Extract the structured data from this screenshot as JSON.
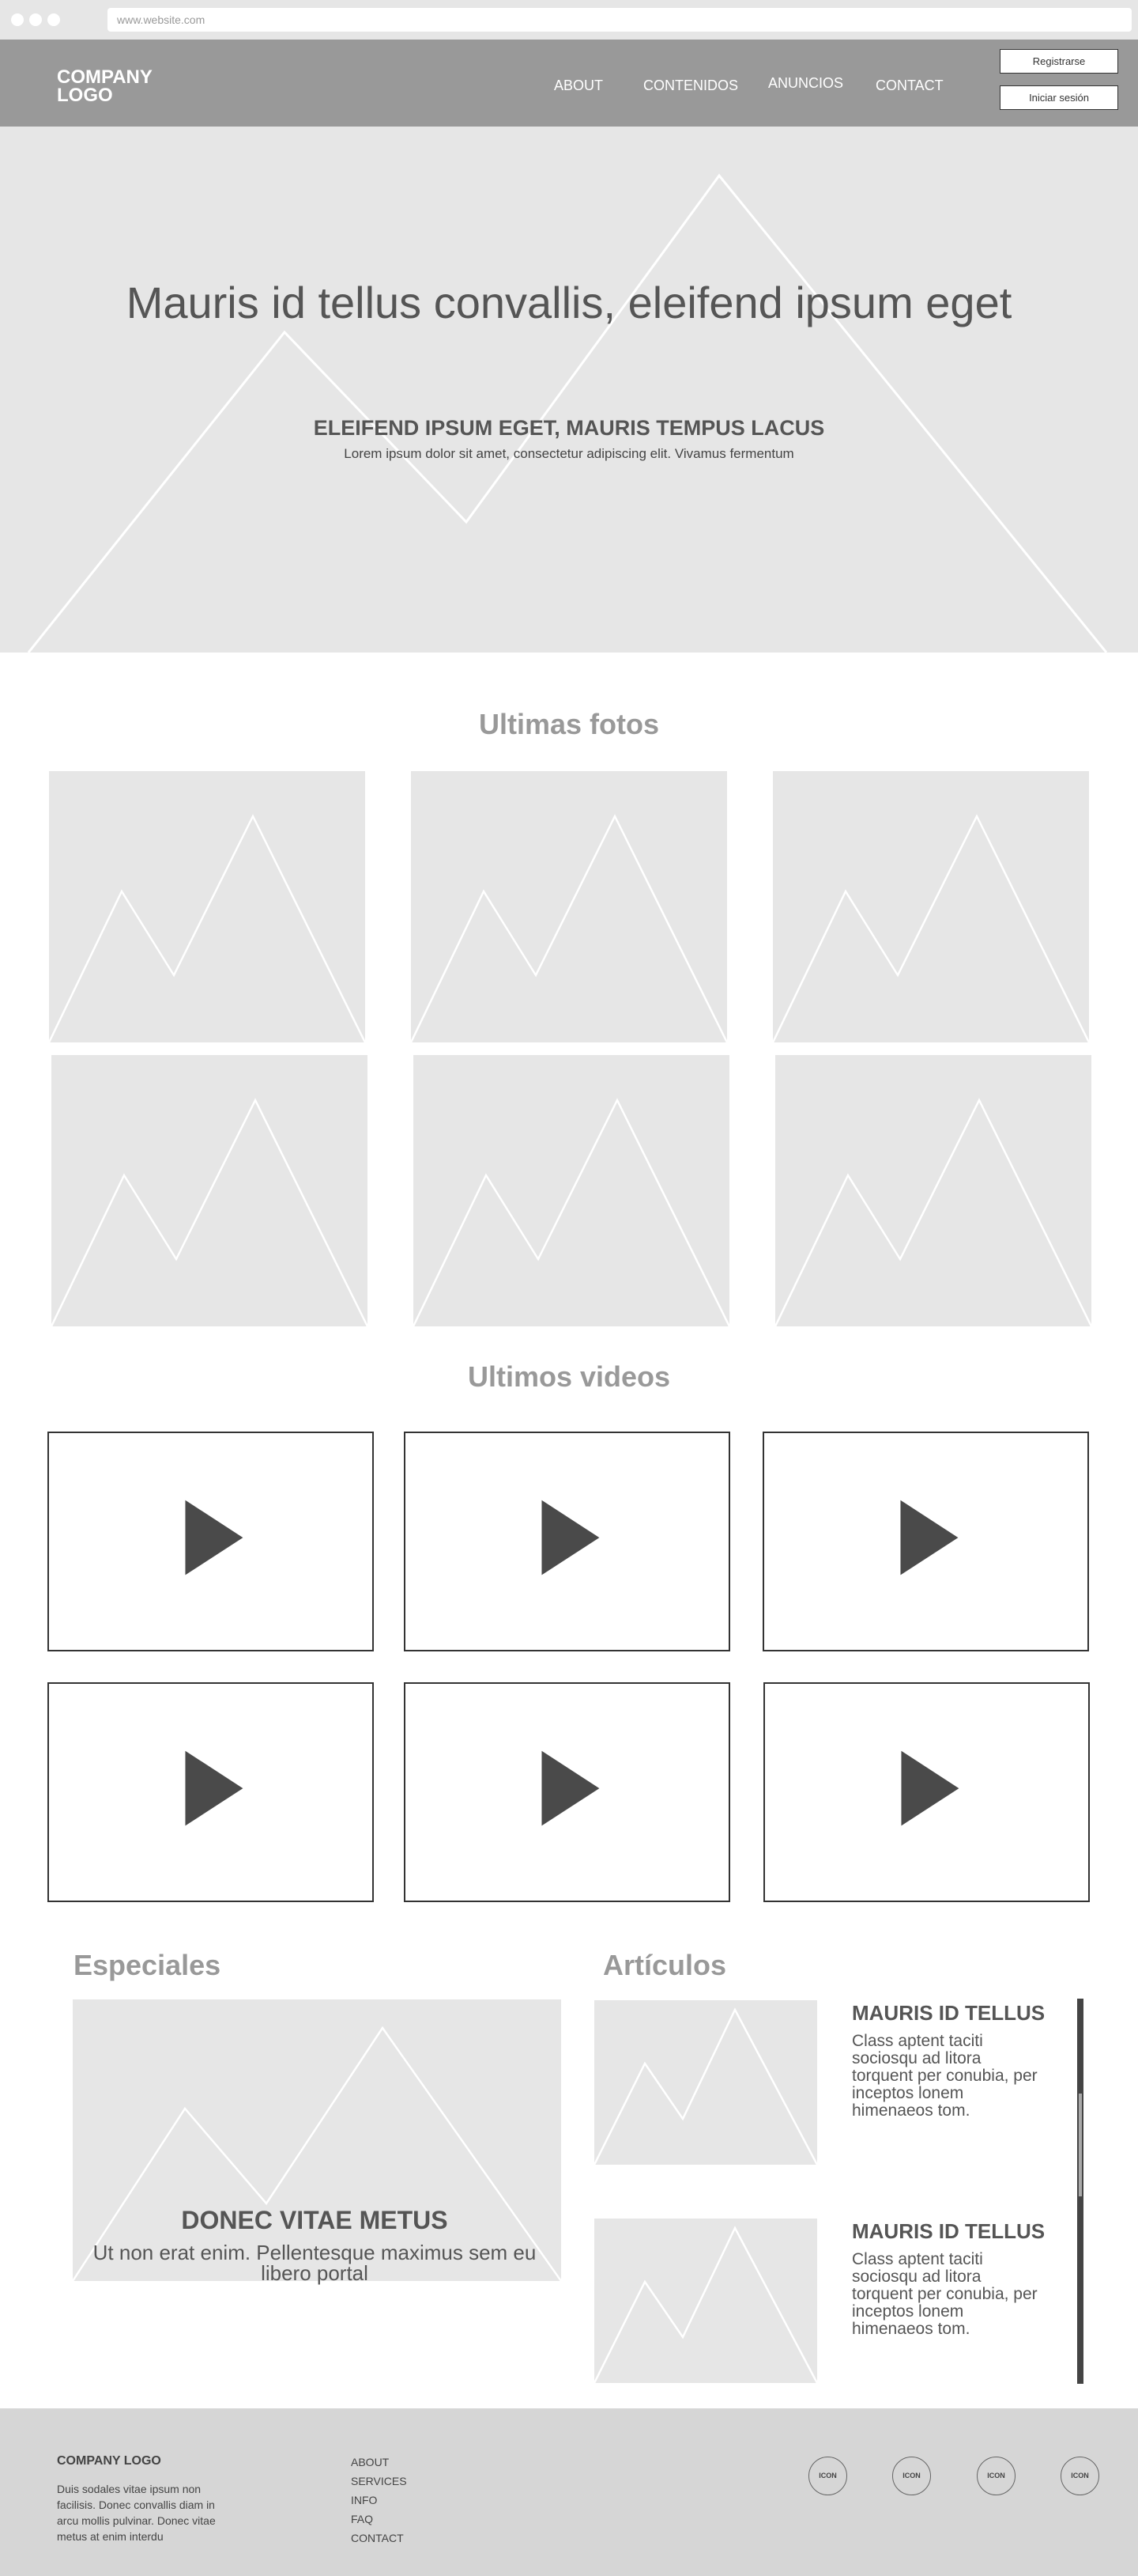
{
  "browser": {
    "url": "www.website.com"
  },
  "header": {
    "logo": "COMPANY LOGO",
    "nav": [
      "ABOUT",
      "CONTENIDOS",
      "ANUNCIOS",
      "CONTACT"
    ],
    "register": "Registrarse",
    "login": "Iniciar sesión"
  },
  "hero": {
    "title": "Mauris id tellus convallis, eleifend ipsum eget",
    "subtitle": "ELEIFEND IPSUM EGET, MAURIS TEMPUS LACUS",
    "description": "Lorem ipsum dolor sit amet, consectetur adipiscing elit. Vivamus fermentum"
  },
  "photos": {
    "title": "Ultimas fotos"
  },
  "videos": {
    "title": "Ultimos videos"
  },
  "especiales": {
    "title": "Especiales",
    "card_title": "DONEC VITAE METUS",
    "card_desc": "Ut non erat enim. Pellentesque maximus sem eu libero portal"
  },
  "articulos": {
    "title": "Artículos",
    "items": [
      {
        "title": "MAURIS ID TELLUS",
        "desc": "Class aptent taciti sociosqu ad litora torquent per conubia, per inceptos lonem himenaeos tom."
      },
      {
        "title": "MAURIS ID TELLUS",
        "desc": "Class aptent taciti sociosqu ad litora torquent per conubia, per inceptos lonem himenaeos tom."
      }
    ]
  },
  "footer": {
    "logo": "COMPANY LOGO",
    "text": "Duis sodales vitae ipsum non facilisis. Donec convallis diam in arcu mollis pulvinar. Donec vitae metus at enim interdu",
    "links": [
      "ABOUT",
      "SERVICES",
      "INFO",
      "FAQ",
      "CONTACT"
    ],
    "icons": [
      "ICON",
      "ICON",
      "ICON",
      "ICON"
    ]
  },
  "colors": {
    "header": "#999999",
    "placeholder": "#e6e6e6",
    "footer": "#d6d6d6",
    "play": "#4a4a4a"
  }
}
